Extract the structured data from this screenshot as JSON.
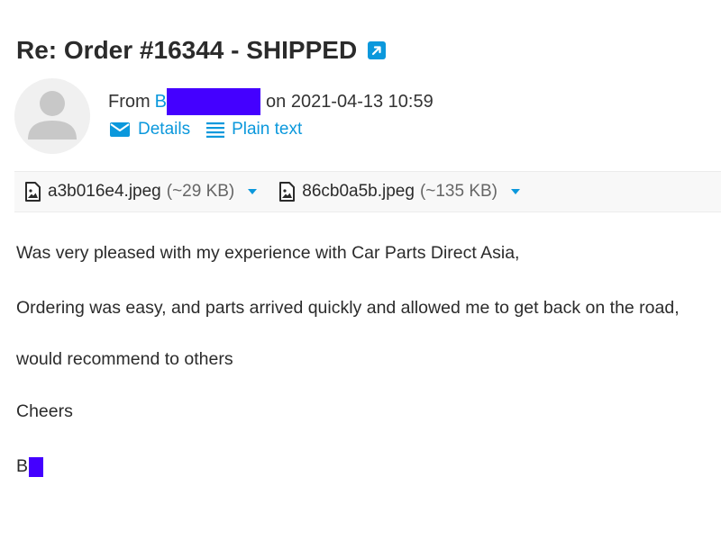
{
  "message": {
    "subject": "Re: Order #16344 - SHIPPED",
    "from_prefix": "From",
    "sender_initial": "B",
    "date_text": "on 2021-04-13 10:59",
    "details_label": "Details",
    "plain_text_label": "Plain text"
  },
  "attachments": [
    {
      "name": "a3b016e4.jpeg",
      "size": "(~29 KB)"
    },
    {
      "name": "86cb0a5b.jpeg",
      "size": "(~135 KB)"
    }
  ],
  "body": {
    "line1": "Was very pleased with my experience with Car Parts Direct Asia,",
    "line2": "Ordering was easy, and parts arrived quickly and allowed me to get back on the road,",
    "line3": "would recommend to others",
    "line4": "Cheers",
    "signature_initial": "B"
  },
  "colors": {
    "accent": "#0b98dc",
    "redaction": "#4400ff",
    "text": "#2b2b2b"
  },
  "icons": [
    "external-link-icon",
    "avatar-placeholder-icon",
    "envelope-icon",
    "menu-lines-icon",
    "image-file-icon",
    "caret-down-icon"
  ]
}
